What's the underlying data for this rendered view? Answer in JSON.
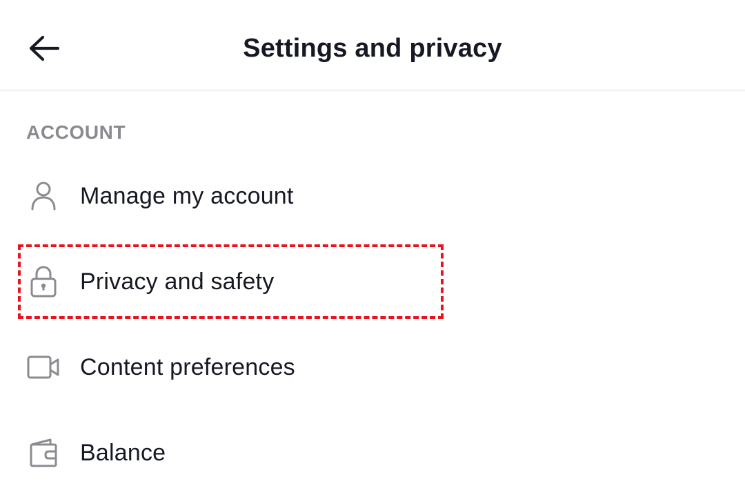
{
  "header": {
    "title": "Settings and privacy",
    "back_icon": "arrow-left-icon"
  },
  "sections": [
    {
      "label": "ACCOUNT",
      "items": [
        {
          "label": "Manage my account",
          "icon": "person-icon"
        },
        {
          "label": "Privacy and safety",
          "icon": "lock-icon",
          "highlighted": true
        },
        {
          "label": "Content preferences",
          "icon": "video-camera-icon"
        },
        {
          "label": "Balance",
          "icon": "wallet-icon"
        }
      ]
    }
  ],
  "colors": {
    "text": "#161823",
    "section_label": "#8a8b91",
    "icon": "#8a8b91",
    "highlight": "#e5141f",
    "divider": "#d8d8db"
  }
}
